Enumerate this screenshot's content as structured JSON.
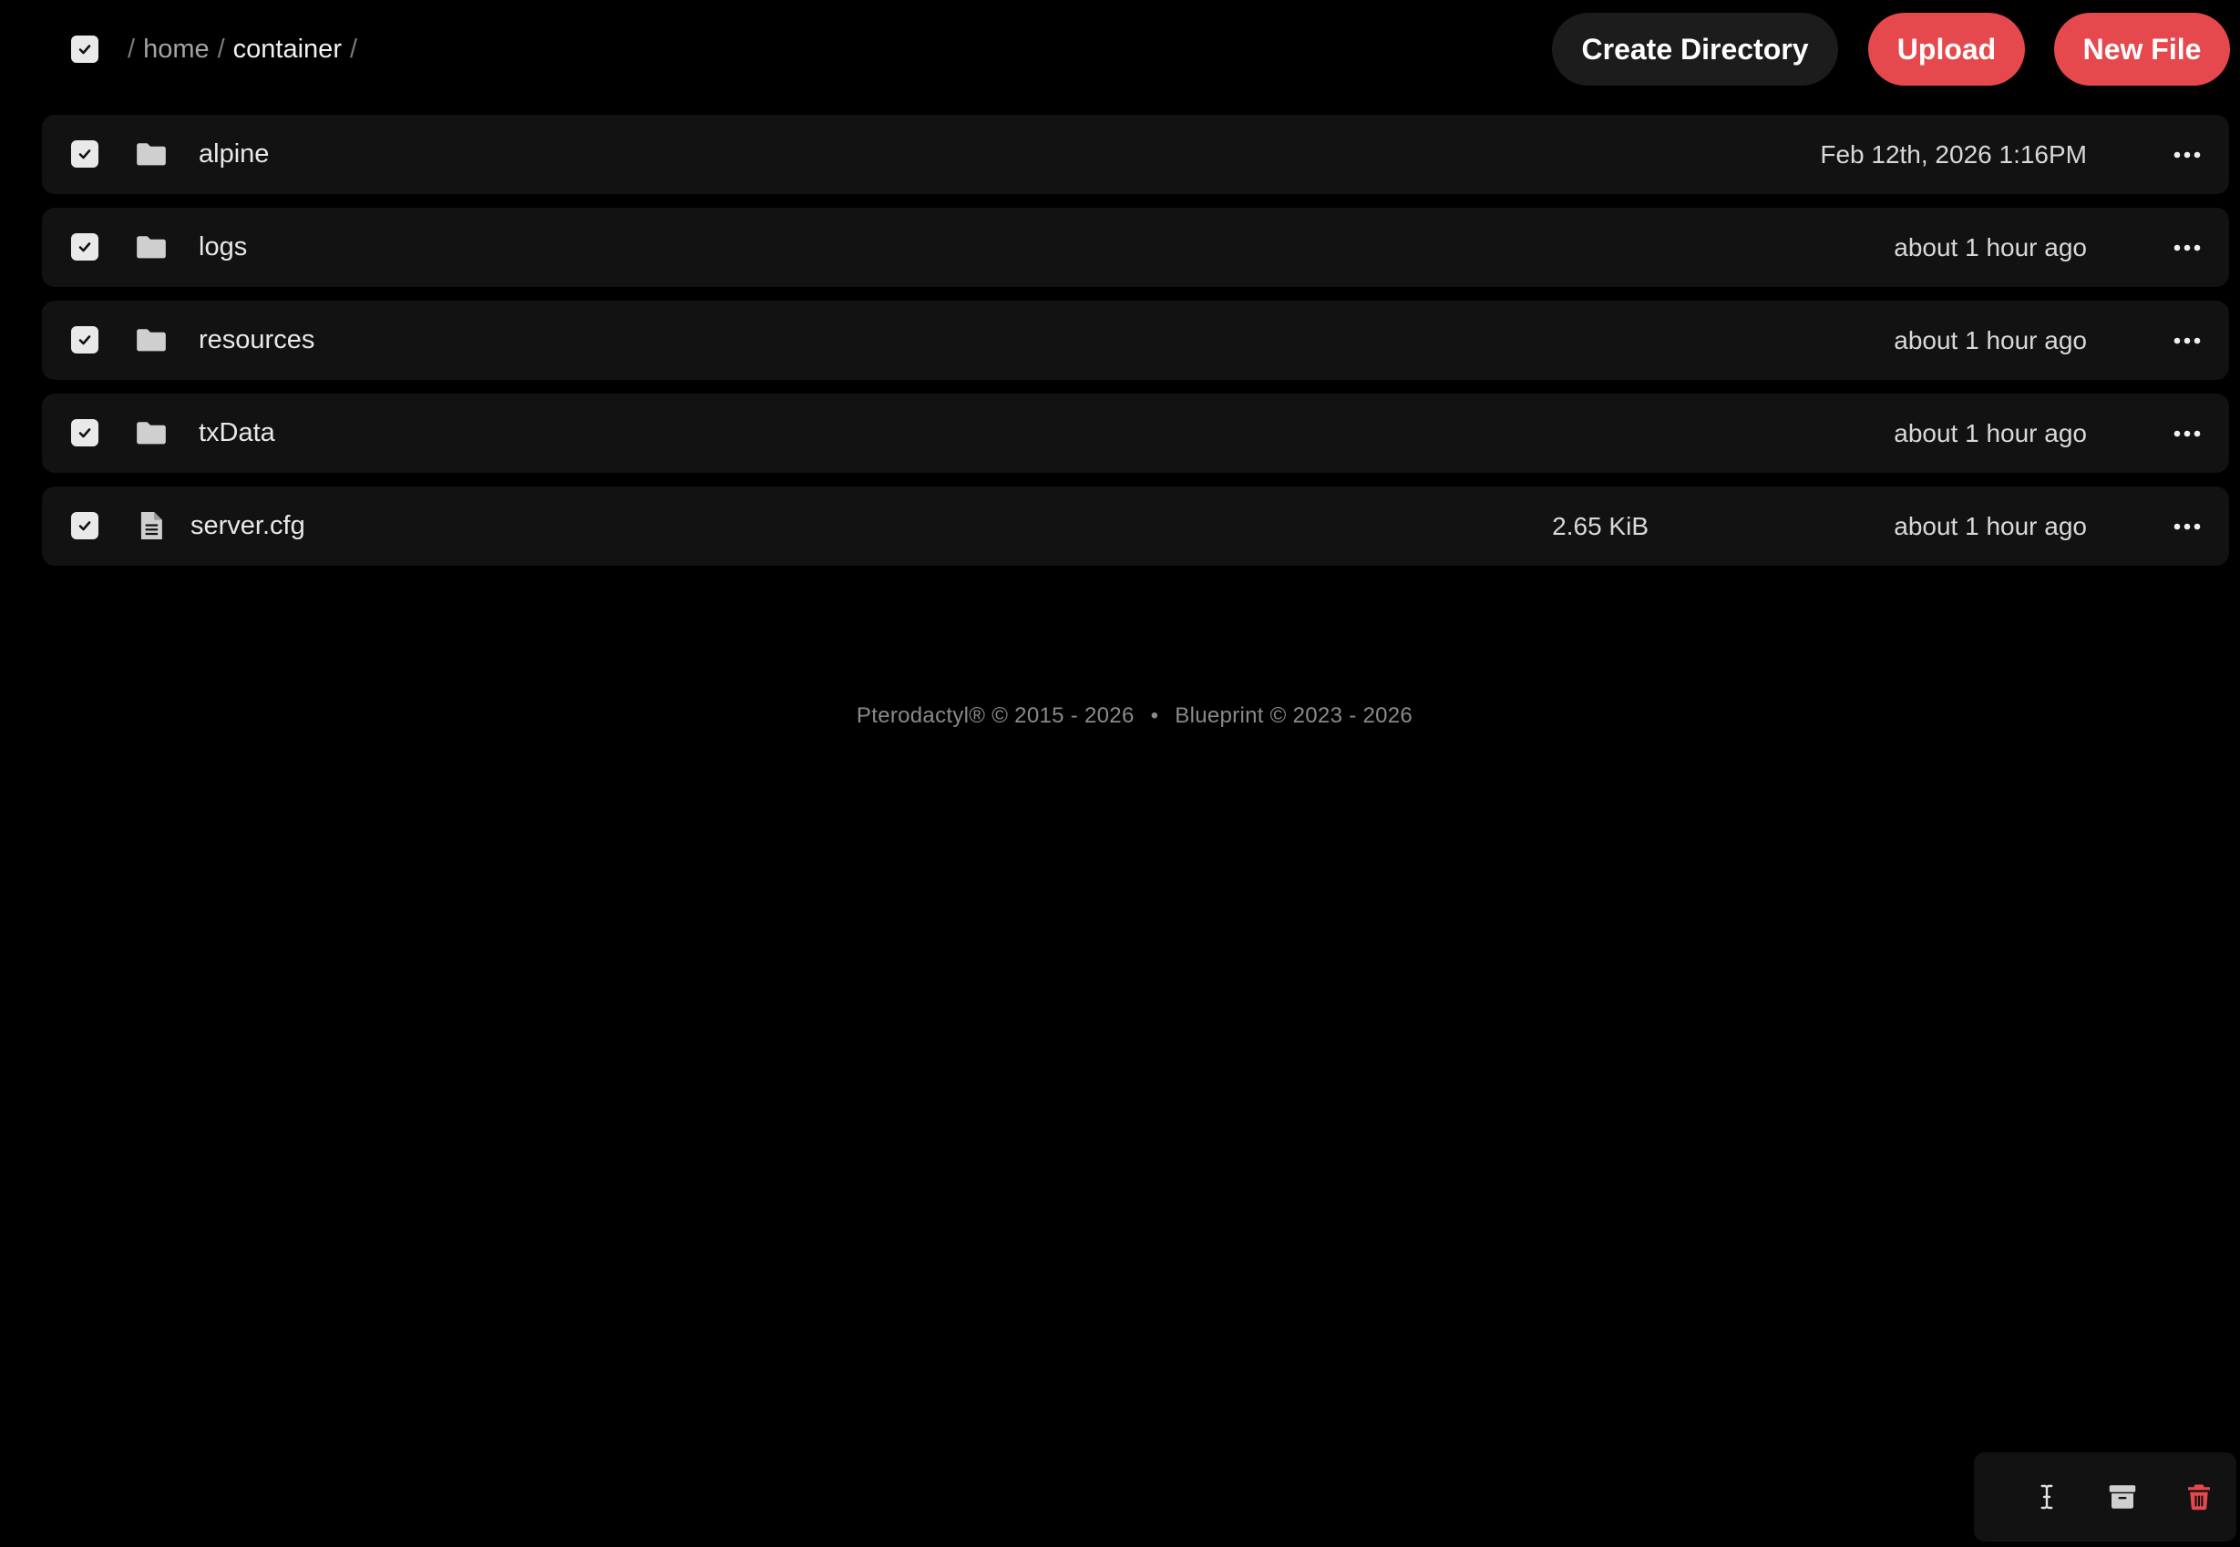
{
  "breadcrumb": {
    "separator": "/",
    "parent": "home",
    "current": "container"
  },
  "actions": {
    "create_directory": "Create Directory",
    "upload": "Upload",
    "new_file": "New File"
  },
  "files": [
    {
      "name": "alpine",
      "type": "folder",
      "size": "",
      "modified": "Feb 12th, 2026 1:16PM"
    },
    {
      "name": "logs",
      "type": "folder",
      "size": "",
      "modified": "about 1 hour ago"
    },
    {
      "name": "resources",
      "type": "folder",
      "size": "",
      "modified": "about 1 hour ago"
    },
    {
      "name": "txData",
      "type": "folder",
      "size": "",
      "modified": "about 1 hour ago"
    },
    {
      "name": "server.cfg",
      "type": "file",
      "size": "2.65 KiB",
      "modified": "about 1 hour ago"
    }
  ],
  "footer": {
    "left": "Pterodactyl® © 2015 - 2026",
    "dot": "•",
    "right": "Blueprint © 2023 - 2026"
  },
  "icons": {
    "checkbox": "check-icon",
    "folder": "folder-icon",
    "file": "file-text-icon",
    "row_menu": "more-horizontal-icon",
    "rename": "text-cursor-icon",
    "archive": "archive-icon",
    "delete": "trash-icon"
  },
  "colors": {
    "background": "#000000",
    "row_background": "#121212",
    "accent": "#e5484d",
    "secondary_button": "#1c1c1c",
    "delete_icon": "#e5484d"
  }
}
